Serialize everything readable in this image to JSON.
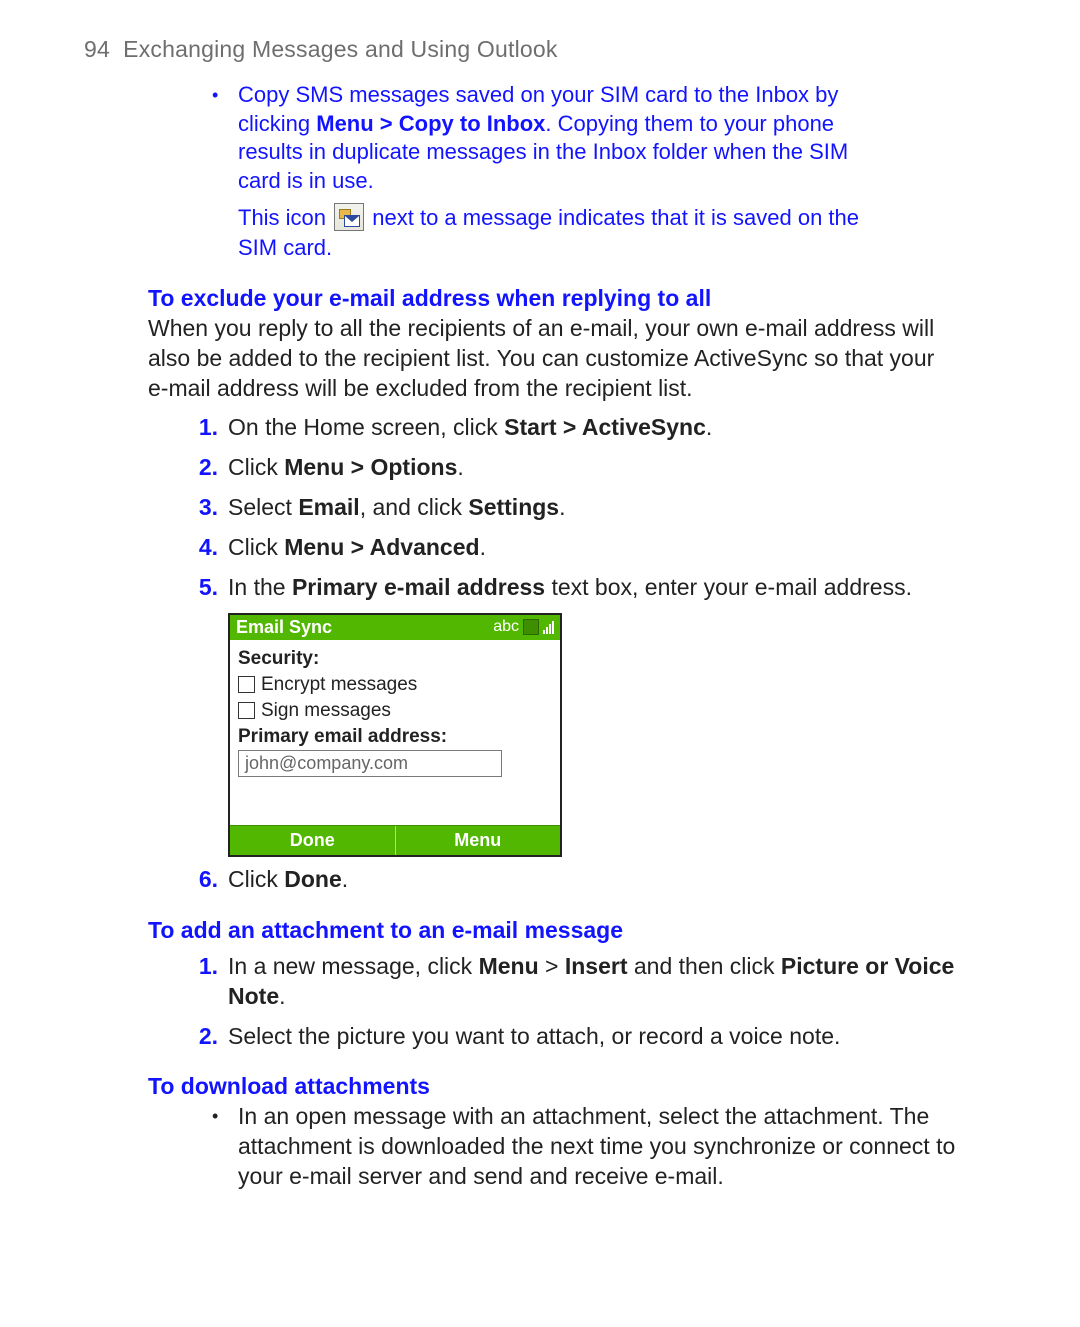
{
  "header": {
    "page_number": "94",
    "chapter_title": "Exchanging Messages and Using Outlook"
  },
  "intro_bullet": {
    "line1": "Copy SMS messages saved on your SIM card to the Inbox by clicking ",
    "bold": "Menu > Copy to Inbox",
    "line2": ". Copying them to your phone results in duplicate messages in the Inbox folder when the SIM card is in use."
  },
  "icon_note": {
    "before": "This icon ",
    "after": " next to a message indicates that it is saved on the SIM card."
  },
  "section1": {
    "heading": "To exclude your e-mail address when replying to all",
    "para": "When you reply to all the recipients of an e-mail, your own e-mail address will also be added to the recipient list. You can customize ActiveSync so that your e-mail address will be excluded from the recipient list.",
    "steps": [
      {
        "num": "1.",
        "pre": "On the Home screen, click ",
        "bold": "Start > ActiveSync",
        "post": "."
      },
      {
        "num": "2.",
        "pre": "Click ",
        "bold": "Menu > Options",
        "post": "."
      },
      {
        "num": "3.",
        "pre": "Select ",
        "bold": "Email",
        "mid": ", and click ",
        "bold2": "Settings",
        "post": "."
      },
      {
        "num": "4.",
        "pre": "Click ",
        "bold": "Menu > Advanced",
        "post": "."
      },
      {
        "num": "5.",
        "pre": "In the ",
        "bold": "Primary e-mail address",
        "post": " text box, enter your e-mail address."
      },
      {
        "num": "6.",
        "pre": "Click ",
        "bold": "Done",
        "post": "."
      }
    ]
  },
  "phone": {
    "title": "Email Sync",
    "mode": "abc",
    "security_label": "Security:",
    "encrypt_label": "Encrypt messages",
    "sign_label": "Sign messages",
    "primary_label": "Primary email address:",
    "primary_value": "john@company.com",
    "softkey_left": "Done",
    "softkey_right": "Menu"
  },
  "section2": {
    "heading": "To add an attachment to an e-mail message",
    "steps": [
      {
        "num": "1.",
        "pre": "In a new message, click ",
        "bold": "Menu",
        "mid": " > ",
        "bold2": "Insert",
        "mid2": " and then click ",
        "bold3": "Picture or Voice Note",
        "post": "."
      },
      {
        "num": "2.",
        "pre": "Select the picture you want to attach, or record a voice note.",
        "bold": "",
        "post": ""
      }
    ]
  },
  "section3": {
    "heading": "To download attachments",
    "bullet": "In an open message with an attachment, select the attachment. The attachment is downloaded the next time you synchronize or connect to your e-mail server and send and receive e-mail."
  }
}
